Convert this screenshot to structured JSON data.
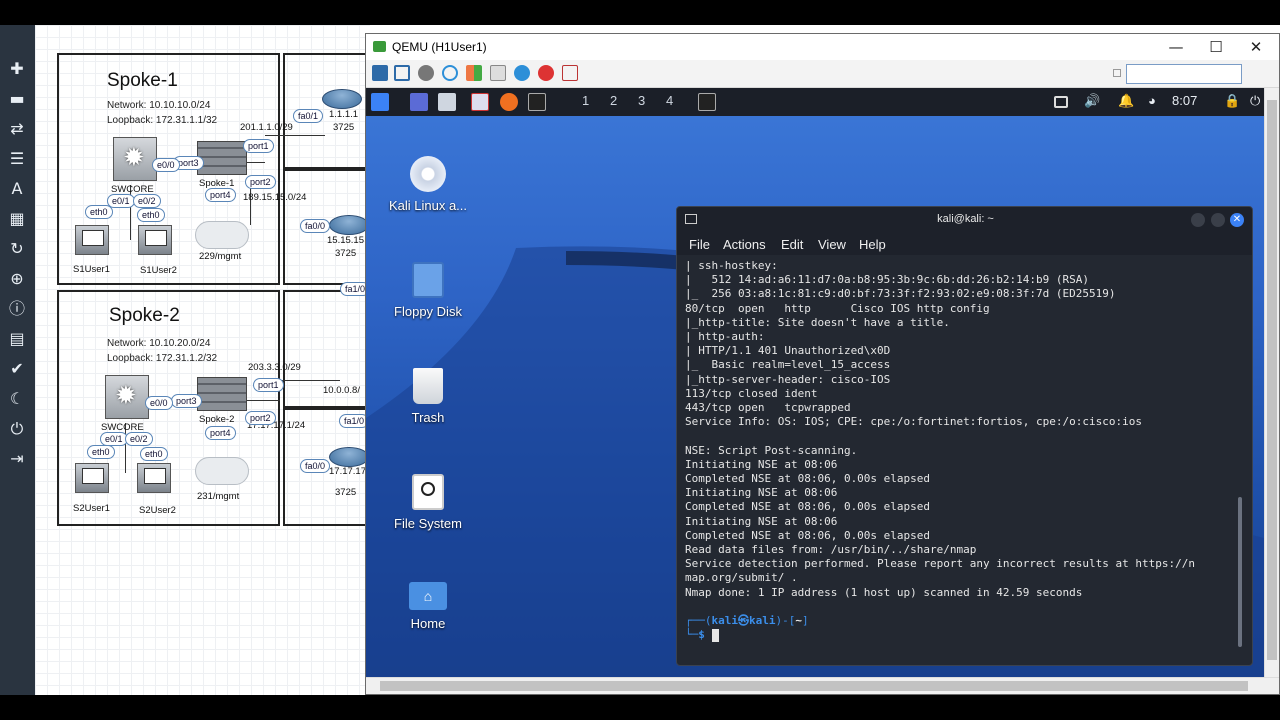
{
  "toolbar": {
    "icons": [
      "plus-icon",
      "drive-icon",
      "transfer-icon",
      "list-icon",
      "text-icon",
      "grid-icon",
      "refresh-icon",
      "zoom-icon",
      "info-icon",
      "log-icon",
      "check-icon",
      "moon-icon",
      "power-icon",
      "exit-icon"
    ]
  },
  "topology": {
    "spoke1": {
      "title": "Spoke-1",
      "network": "Network: 10.10.10.0/24",
      "loopback": "Loopback: 172.31.1.1/32"
    },
    "spoke2": {
      "title": "Spoke-2",
      "network": "Network: 10.10.20.0/24",
      "loopback": "Loopback: 172.31.1.2/32"
    },
    "labels": {
      "s1_swcore": "SWCORE",
      "s1_fw": "Spoke-1",
      "s1_user1": "S1User1",
      "s1_user2": "S1User2",
      "s1_mgmt": "229/mgmt",
      "s1_wan": "201.1.1.0/29",
      "s1_wan2": "189.15.15.0/24",
      "r1_ip": "1.1.1.1",
      "r1_model": "3725",
      "r2_ip": "15.15.15",
      "r2_model": "3725",
      "s2_swcore": "SWCORE",
      "s2_fw": "Spoke-2",
      "s2_user1": "S2User1",
      "s2_user2": "S2User2",
      "s2_mgmt": "231/mgmt",
      "s2_wan": "203.3.3.0/29",
      "s2_wan2": "17.17.17.1/24",
      "r3_ip": "10.0.0.8/",
      "r4_ip": "17.17.17",
      "r4_model": "3725"
    },
    "pills": {
      "fa01_a": "fa0/1",
      "port1_a": "port1",
      "port3_a": "port3",
      "e00_a": "e0/0",
      "port2_a": "port2",
      "port4_a": "port4",
      "eth0_a": "eth0",
      "e01_a": "e0/1",
      "e02_a": "e0/2",
      "eth0_b": "eth0",
      "fa00_a": "fa0/0",
      "fa10_a": "fa1/0",
      "port1_b": "port1",
      "port3_b": "port3",
      "e00_b": "e0/0",
      "port2_b": "port2",
      "port4_b": "port4",
      "eth0_c": "eth0",
      "e01_b": "e0/1",
      "e02_b": "e0/2",
      "eth0_d": "eth0",
      "fa10_b": "fa1/0",
      "fa00_b": "fa0/0"
    }
  },
  "qemu": {
    "title": "QEMU (H1User1)",
    "buttons": {
      "minimize": "—",
      "maximize": "☐",
      "close": "✕"
    }
  },
  "kali": {
    "workspaces": [
      "1",
      "2",
      "3",
      "4"
    ],
    "clock": "8:07",
    "desktop_icons": [
      {
        "label": "Kali Linux a..."
      },
      {
        "label": "Floppy Disk"
      },
      {
        "label": "Trash"
      },
      {
        "label": "File System"
      },
      {
        "label": "Home"
      }
    ],
    "terminal": {
      "title": "kali@kali: ~",
      "menu": [
        "File",
        "Actions",
        "Edit",
        "View",
        "Help"
      ],
      "lines": [
        "| ssh-hostkey:",
        "|   512 14:ad:a6:11:d7:0a:b8:95:3b:9c:6b:dd:26:b2:14:b9 (RSA)",
        "|_  256 03:a8:1c:81:c9:d0:bf:73:3f:f2:93:02:e9:08:3f:7d (ED25519)",
        "80/tcp  open   http      Cisco IOS http config",
        "|_http-title: Site doesn't have a title.",
        "| http-auth:",
        "| HTTP/1.1 401 Unauthorized\\x0D",
        "|_  Basic realm=level_15_access",
        "|_http-server-header: cisco-IOS",
        "113/tcp closed ident",
        "443/tcp open   tcpwrapped",
        "Service Info: OS: IOS; CPE: cpe:/o:fortinet:fortios, cpe:/o:cisco:ios",
        "",
        "NSE: Script Post-scanning.",
        "Initiating NSE at 08:06",
        "Completed NSE at 08:06, 0.00s elapsed",
        "Initiating NSE at 08:06",
        "Completed NSE at 08:06, 0.00s elapsed",
        "Initiating NSE at 08:06",
        "Completed NSE at 08:06, 0.00s elapsed",
        "Read data files from: /usr/bin/../share/nmap",
        "Service detection performed. Please report any incorrect results at https://n",
        "map.org/submit/ .",
        "Nmap done: 1 IP address (1 host up) scanned in 42.59 seconds",
        ""
      ],
      "prompt_user": "kali",
      "prompt_at": "㉿",
      "prompt_host": "kali",
      "prompt_dir": "~",
      "prompt_symbol": "$"
    }
  },
  "colors": {
    "prompt": "#3b8eea",
    "terminal_bg": "#232831",
    "desktop": "#2e64c6"
  }
}
